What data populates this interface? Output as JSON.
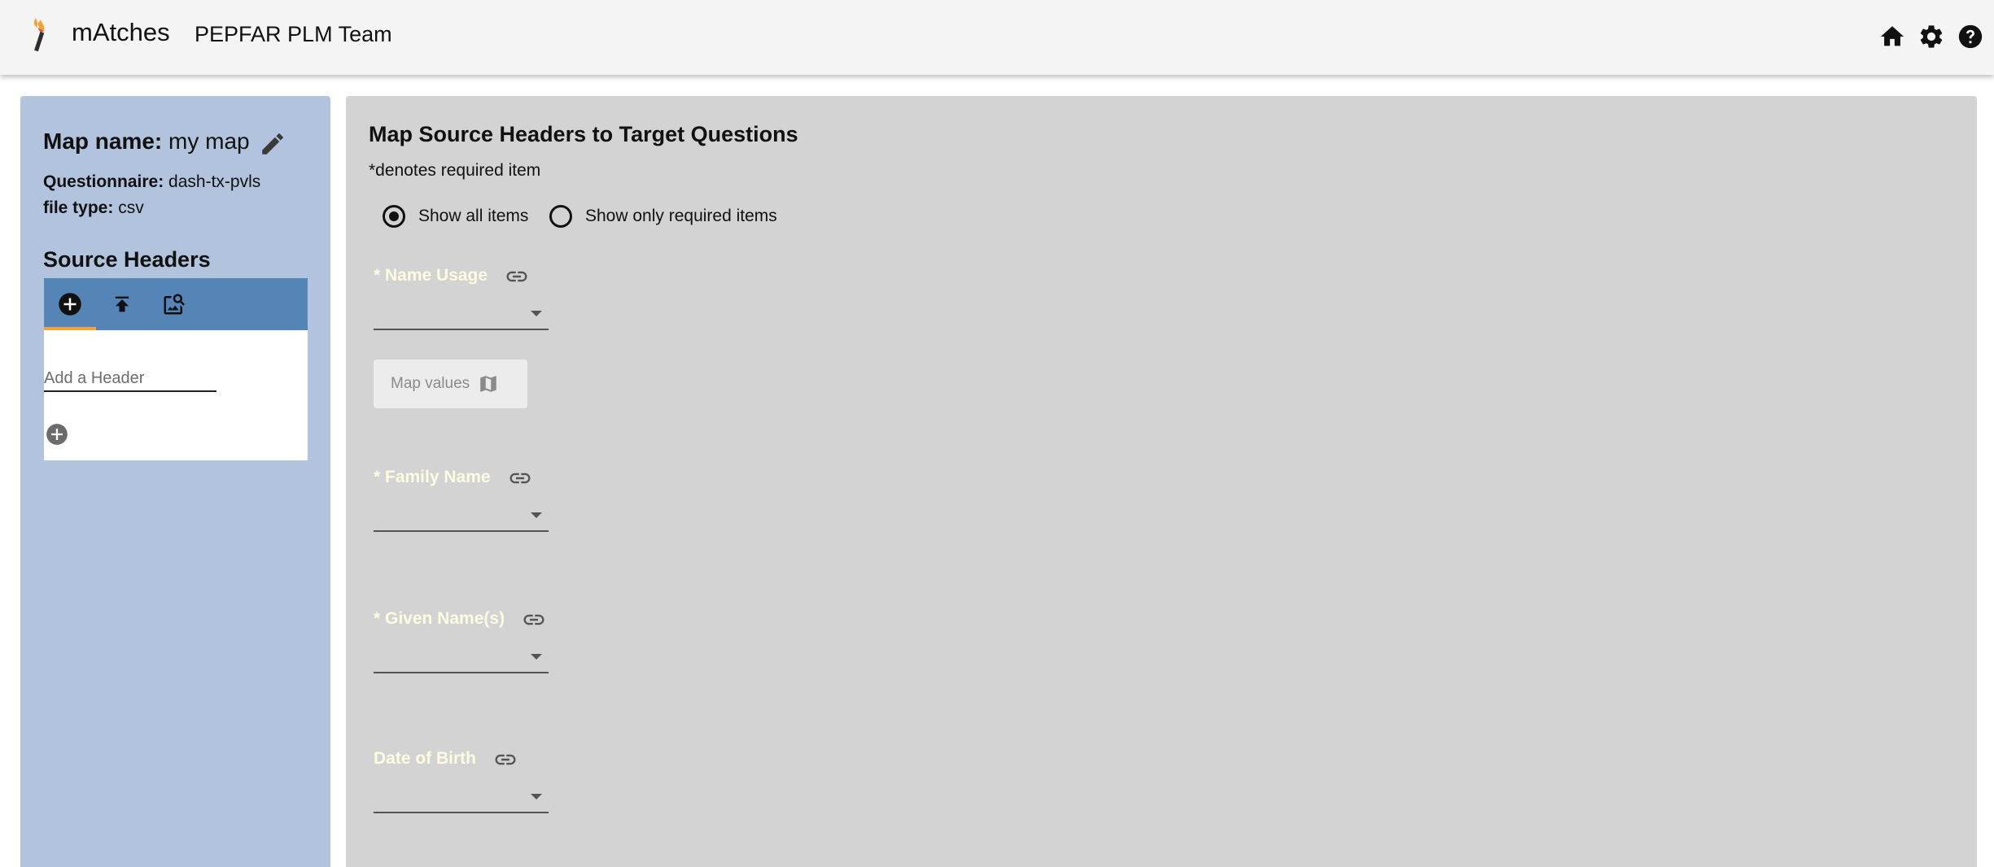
{
  "header": {
    "app_title": "mAtches",
    "team_name": "PEPFAR PLM Team",
    "icons": [
      "home-icon",
      "settings-icon",
      "help-icon"
    ]
  },
  "sidebar": {
    "map_name_label": "Map name:",
    "map_name_value": "my map",
    "questionnaire_label": "Questionnaire:",
    "questionnaire_value": "dash-tx-pvls",
    "file_type_label": "file type:",
    "file_type_value": "csv",
    "source_headers_title": "Source Headers",
    "tabs": [
      "add-circle-icon",
      "upload-icon",
      "image-search-icon"
    ],
    "add_header_placeholder": "Add a Header"
  },
  "main": {
    "title": "Map Source Headers to Target Questions",
    "required_note": "*denotes required item",
    "filter_options": [
      {
        "label": "Show all items",
        "selected": true
      },
      {
        "label": "Show only required items",
        "selected": false
      }
    ],
    "fields": [
      {
        "label": "* Name Usage",
        "value": ""
      },
      {
        "label": "* Family Name",
        "value": ""
      },
      {
        "label": "* Given Name(s)",
        "value": ""
      },
      {
        "label": "Date of Birth",
        "value": ""
      }
    ],
    "map_values_label": "Map values"
  },
  "colors": {
    "appbar": "#f4f4f4",
    "sidebar": "#b2c3dd",
    "tabbar": "#5584b6",
    "tab_indicator": "#f4a236",
    "main": "#d3d3d3",
    "field_label": "#fefbe0"
  }
}
